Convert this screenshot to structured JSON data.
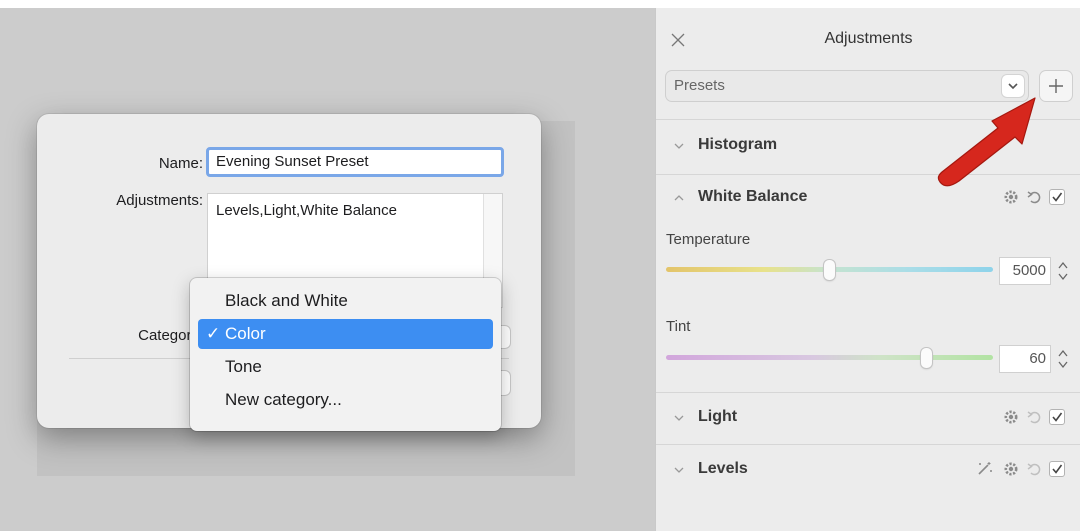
{
  "dialog": {
    "name_label": "Name:",
    "name_value": "Evening Sunset Preset",
    "adjustments_label": "Adjustments:",
    "adjustments_value": "Levels,Light,White Balance",
    "category_label": "Category"
  },
  "category_menu": {
    "items": [
      {
        "label": "Black and White",
        "selected": false
      },
      {
        "label": "Color",
        "selected": true
      },
      {
        "label": "Tone",
        "selected": false
      },
      {
        "label": "New category...",
        "selected": false
      }
    ],
    "checkmark": "✓"
  },
  "panel": {
    "title": "Adjustments",
    "presets_label": "Presets",
    "sections": {
      "histogram": {
        "title": "Histogram"
      },
      "white_balance": {
        "title": "White Balance",
        "temperature": {
          "label": "Temperature",
          "value": "5000"
        },
        "tint": {
          "label": "Tint",
          "value": "60"
        }
      },
      "light": {
        "title": "Light"
      },
      "levels": {
        "title": "Levels"
      }
    }
  },
  "colors": {
    "menu_highlight": "#3d8ef2",
    "focus_ring": "#7aa7e8",
    "annotation_arrow": "#d6271d"
  },
  "icons": [
    "close-icon",
    "chevron-down-icon",
    "plus-icon",
    "chevron-up-icon",
    "gear-icon",
    "revert-icon",
    "checkmark-icon",
    "auto-enhance-icon",
    "stepper-icon"
  ]
}
